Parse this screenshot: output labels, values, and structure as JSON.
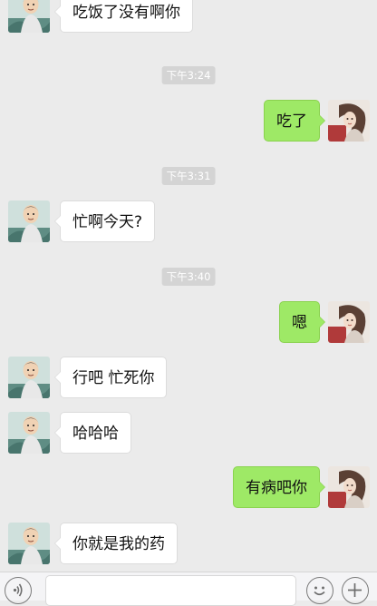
{
  "conversation": {
    "messages": [
      {
        "side": "in",
        "text": "吃饭了没有啊你"
      },
      {
        "side": "timestamp",
        "text": "下午3:24"
      },
      {
        "side": "out",
        "text": "吃了"
      },
      {
        "side": "timestamp",
        "text": "下午3:31"
      },
      {
        "side": "in",
        "text": "忙啊今天?"
      },
      {
        "side": "timestamp",
        "text": "下午3:40"
      },
      {
        "side": "out",
        "text": "嗯"
      },
      {
        "side": "in",
        "text": "行吧 忙死你"
      },
      {
        "side": "in",
        "text": "哈哈哈"
      },
      {
        "side": "out",
        "text": "有病吧你"
      },
      {
        "side": "in",
        "text": "你就是我的药"
      }
    ]
  },
  "input_bar": {
    "voice_icon": "voice-icon",
    "emoji_icon": "emoji-icon",
    "plus_icon": "plus-icon",
    "text_value": ""
  },
  "colors": {
    "background": "#ebebeb",
    "incoming_bubble": "#ffffff",
    "outgoing_bubble": "#9ee966",
    "timestamp_pill": "#d4d4d4"
  }
}
